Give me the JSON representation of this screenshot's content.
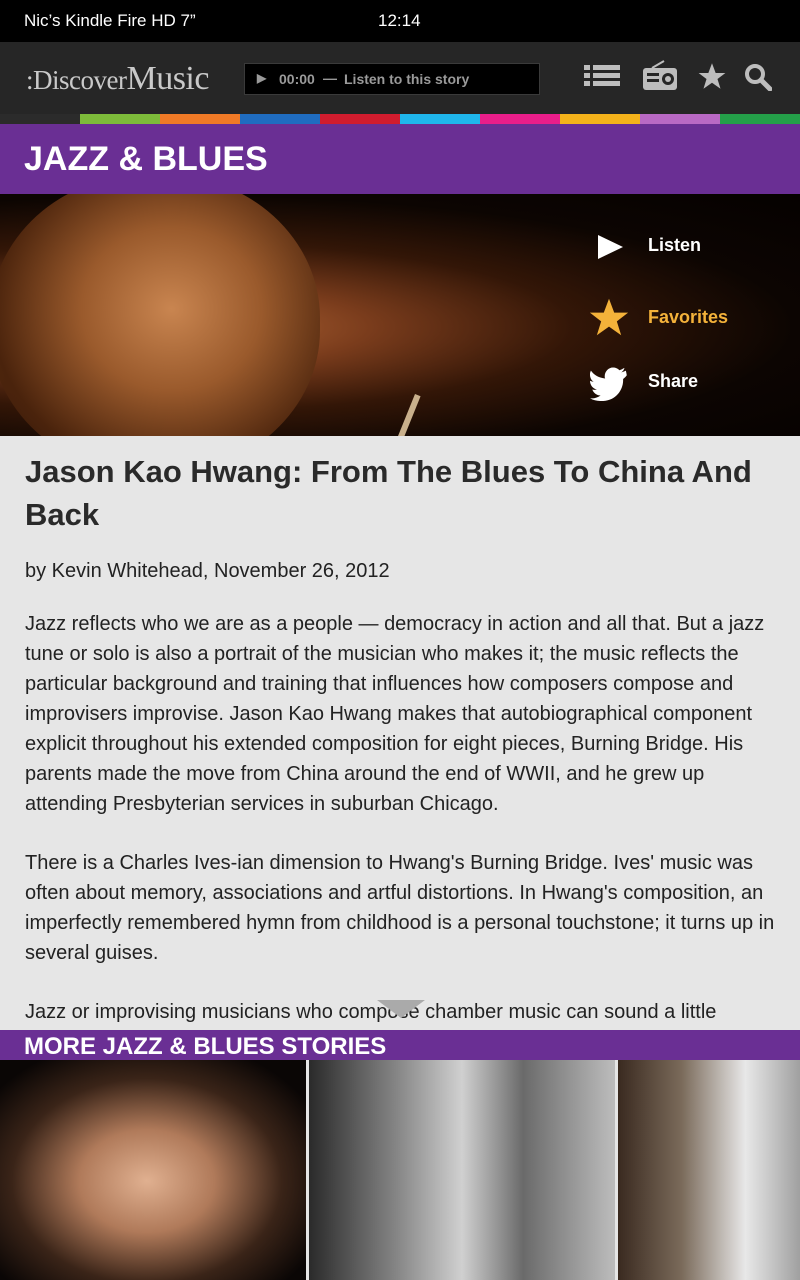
{
  "status_bar": {
    "device_name": "Nic’s Kindle Fire HD 7”",
    "time": "12:14"
  },
  "app": {
    "logo_prefix": ":Discover",
    "logo_suffix": "Music",
    "player": {
      "play_icon": "play-icon",
      "time": "00:00",
      "separator": "—",
      "label": "Listen to this story"
    },
    "nav_icons": [
      "list-icon",
      "radio-icon",
      "star-icon",
      "search-icon"
    ]
  },
  "color_strip": [
    "#2b2b2b",
    "#7dbb3a",
    "#f07a26",
    "#1f6cc0",
    "#d11c2e",
    "#1fb6ec",
    "#ea1e8a",
    "#f4b21a",
    "#b969c4",
    "#24a049"
  ],
  "category": {
    "title": "JAZZ & BLUES",
    "accent": "#6a2f94"
  },
  "hero_actions": [
    {
      "icon": "play-icon",
      "label": "Listen",
      "color": "#ffffff"
    },
    {
      "icon": "star-icon",
      "label": "Favorites",
      "color": "#f4b23a"
    },
    {
      "icon": "twitter-icon",
      "label": "Share",
      "color": "#ffffff"
    }
  ],
  "article": {
    "title": "Jason Kao Hwang: From The Blues To China And Back",
    "byline": "by Kevin Whitehead, November 26, 2012",
    "paragraphs": [
      "Jazz reflects who we are as a people — democracy in action and all that. But a jazz tune or solo is also a portrait of the musician who makes it; the music reflects the particular background and training that influences how composers compose and improvisers improvise. Jason Kao Hwang makes that autobiographical component explicit throughout his extended composition for eight pieces, Burning Bridge. His parents made the move from China around the end of WWII, and he grew up attending Presbyterian services in suburban Chicago.",
      "There is a Charles Ives-ian dimension to Hwang's Burning Bridge. Ives' music was often about memory, associations and artful distortions. In Hwang's composition, an imperfectly remembered hymn from childhood is a personal touchstone; it turns up in several guises.",
      "Jazz or improvising musicians who compose chamber music can sound a little"
    ]
  },
  "more_stories": {
    "title": "MORE JAZZ & BLUES STORIES"
  }
}
